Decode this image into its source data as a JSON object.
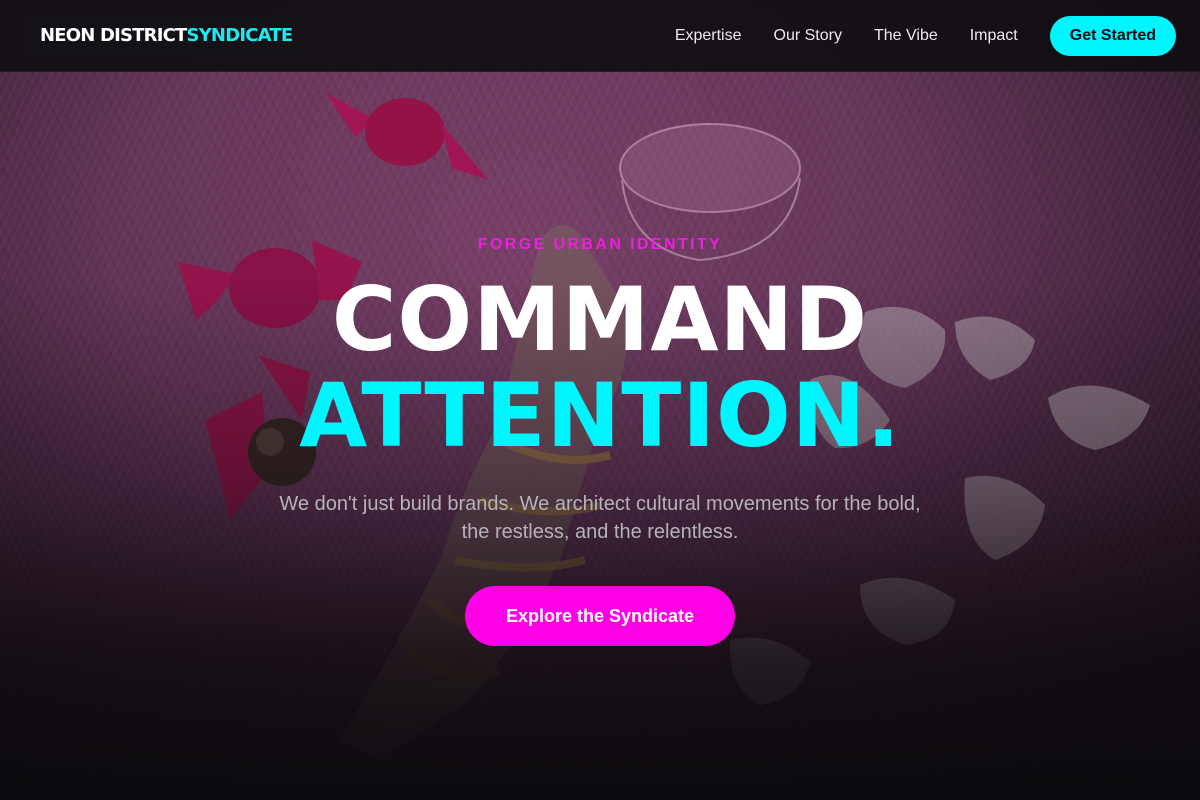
{
  "brand": {
    "name_part_1": "NEON DISTRICT",
    "name_part_2": "SYNDICATE"
  },
  "nav": {
    "items": [
      {
        "label": "Expertise"
      },
      {
        "label": "Our Story"
      },
      {
        "label": "The Vibe"
      },
      {
        "label": "Impact"
      }
    ],
    "cta_label": "Get Started"
  },
  "hero": {
    "eyebrow": "FORGE URBAN IDENTITY",
    "headline_line_1": "COMMAND",
    "headline_line_2": "ATTENTION.",
    "subheadline": "We don't just build brands. We architect cultural movements for the bold, the restless, and the relentless.",
    "button_label": "Explore the Syndicate"
  },
  "colors": {
    "accent_cyan": "#00f5ff",
    "accent_magenta": "#ff00e6",
    "background": "#0d0b0f"
  }
}
